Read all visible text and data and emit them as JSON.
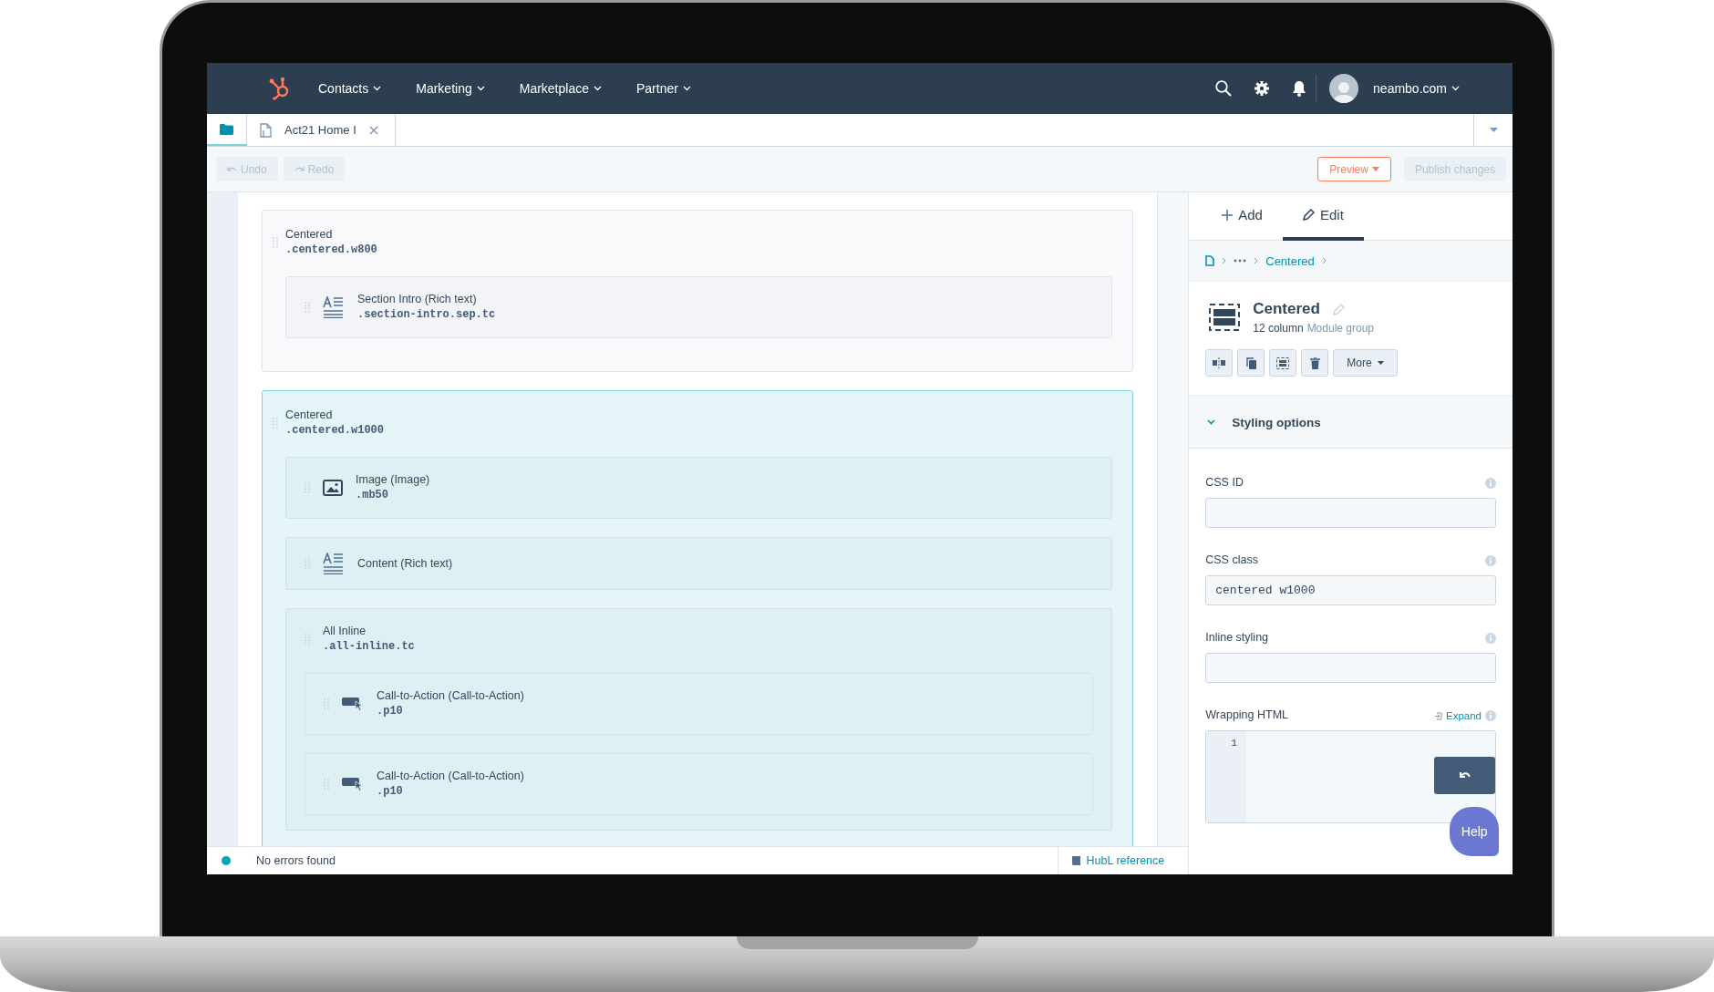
{
  "nav": {
    "items": [
      {
        "label": "Contacts"
      },
      {
        "label": "Marketing"
      },
      {
        "label": "Marketplace"
      },
      {
        "label": "Partner"
      }
    ],
    "account": "neambo.com"
  },
  "editor_tabs": [
    {
      "label": "Act21 Home I"
    }
  ],
  "toolbar": {
    "undo": {
      "label": "Undo",
      "disabled": true
    },
    "redo": {
      "label": "Redo",
      "disabled": true
    },
    "preview": {
      "label": "Preview",
      "disabled": false
    },
    "publish": {
      "label": "Publish changes",
      "disabled": true
    }
  },
  "canvas": {
    "sections": [
      {
        "title": "Centered",
        "css": ".centered.w800",
        "selected": false,
        "modules": [
          {
            "kind": "rich-text",
            "title": "Section Intro (Rich text)",
            "css": ".section-intro.sep.tc"
          }
        ]
      },
      {
        "title": "Centered",
        "css": ".centered.w1000",
        "selected": true,
        "modules": [
          {
            "kind": "image",
            "title": "Image (Image)",
            "css": ".mb50"
          },
          {
            "kind": "rich-text",
            "title": "Content (Rich text)"
          },
          {
            "kind": "group",
            "title": "All Inline",
            "css": ".all-inline.tc",
            "children": [
              {
                "kind": "cta",
                "title": "Call-to-Action (Call-to-Action)",
                "css": ".p10"
              },
              {
                "kind": "cta",
                "title": "Call-to-Action (Call-to-Action)",
                "css": ".p10"
              }
            ]
          }
        ]
      }
    ]
  },
  "status_bar": {
    "message": "No errors found",
    "link": "HubL reference"
  },
  "panel": {
    "tabs": [
      {
        "label": "Add",
        "kind": "add",
        "selected": false
      },
      {
        "label": "Edit",
        "kind": "edit",
        "selected": true
      }
    ],
    "breadcrumb": {
      "current": "Centered"
    },
    "header": {
      "title": "Centered",
      "columns": "12 column",
      "type": "Module group"
    },
    "more": "More",
    "styling": {
      "label": "Styling options",
      "expanded": true
    },
    "fields": [
      {
        "kind": "input",
        "label": "CSS ID"
      },
      {
        "kind": "input",
        "label": "CSS class",
        "value": "centered w1000"
      },
      {
        "kind": "input",
        "label": "Inline styling"
      },
      {
        "kind": "code",
        "label": "Wrapping HTML",
        "action": "Expand",
        "line_numbers": [
          "1"
        ]
      }
    ],
    "help": "Help"
  }
}
